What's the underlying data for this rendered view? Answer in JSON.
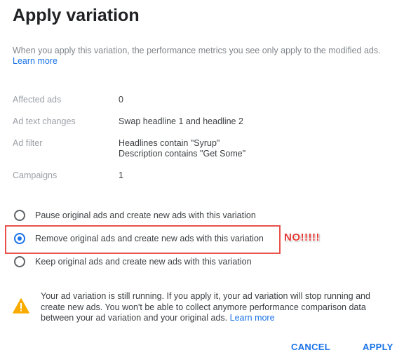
{
  "dialog": {
    "title": "Apply variation",
    "intro": "When you apply this variation, the performance metrics you see only apply to the modified ads.",
    "learn_more": "Learn more"
  },
  "details": [
    {
      "label": "Affected ads",
      "value": "0"
    },
    {
      "label": "Ad text changes",
      "value": "Swap headline 1 and headline 2"
    },
    {
      "label": "Ad filter",
      "value": "Headlines contain \"Syrup\"",
      "value2": "Description contains \"Get Some\""
    },
    {
      "label": "Campaigns",
      "value": "1"
    }
  ],
  "options": [
    {
      "label": "Pause original ads and create new ads with this variation",
      "selected": false
    },
    {
      "label": "Remove original ads and create new ads with this variation",
      "selected": true
    },
    {
      "label": "Keep original ads and create new ads with this variation",
      "selected": false
    }
  ],
  "annotation": "NO!!!!!",
  "warning": {
    "text": "Your ad variation is still running. If you apply it, your ad variation will stop running and create new ads. You won't be able to collect anymore performance comparison data between your ad variation and your original ads.",
    "learn_more": "Learn more"
  },
  "actions": {
    "cancel": "CANCEL",
    "apply": "APPLY"
  },
  "colors": {
    "accent": "#1a73e8",
    "warning": "#f9ab00",
    "annotation": "#e53935"
  }
}
